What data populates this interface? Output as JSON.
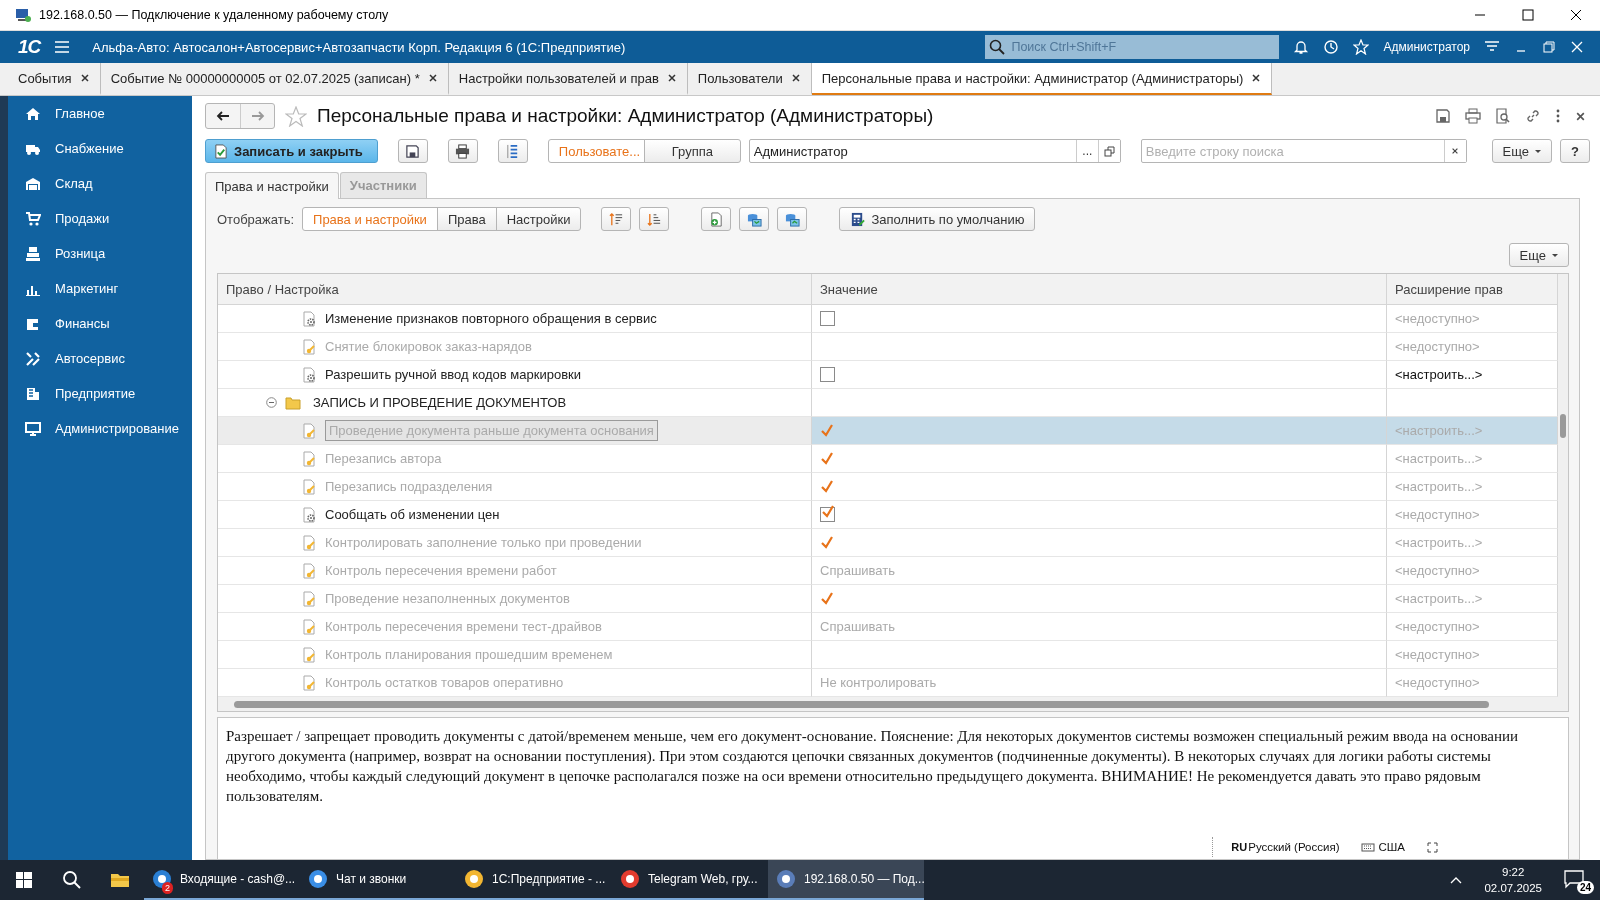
{
  "remote_window": {
    "title": "192.168.0.50 — Подключение к удаленному рабочему столу"
  },
  "app_header": {
    "logo": "1С",
    "title": "Альфа-Авто: Автосалон+Автосервис+Автозапчасти Корп. Редакция 6  (1С:Предприятие)",
    "search": {
      "placeholder": "Поиск Ctrl+Shift+F"
    },
    "user": "Администратор"
  },
  "open_tabs": [
    {
      "label": "События",
      "selected": false
    },
    {
      "label": "Событие № 00000000005 от 02.07.2025 (записан) *",
      "selected": false
    },
    {
      "label": "Настройки пользователей и прав",
      "selected": false
    },
    {
      "label": "Пользователи",
      "selected": false
    },
    {
      "label": "Персональные права и настройки: Администратор (Администраторы)",
      "selected": true
    }
  ],
  "sidebar": {
    "items": [
      {
        "label": "Главное"
      },
      {
        "label": "Снабжение"
      },
      {
        "label": "Склад"
      },
      {
        "label": "Продажи"
      },
      {
        "label": "Розница"
      },
      {
        "label": "Маркетинг"
      },
      {
        "label": "Финансы"
      },
      {
        "label": "Автосервис"
      },
      {
        "label": "Предприятие"
      },
      {
        "label": "Администрирование"
      }
    ]
  },
  "form": {
    "title": "Персональные права и настройки: Администратор (Администраторы)",
    "toolbar": {
      "save_close": "Записать и закрыть",
      "mode_toggle": [
        {
          "label": "Пользовате...",
          "selected": true
        },
        {
          "label": "Группа",
          "selected": false
        }
      ],
      "user_field": {
        "value": "Администратор",
        "select_button": "..."
      },
      "search": {
        "placeholder": "Введите строку поиска"
      },
      "more": "Еще",
      "help": "?"
    },
    "tabs": [
      {
        "label": "Права и настройки",
        "selected": true
      },
      {
        "label": "Участники",
        "selected": false
      }
    ],
    "filter": {
      "label": "Отображать:",
      "options": [
        {
          "label": "Права и настройки",
          "selected": true
        },
        {
          "label": "Права",
          "selected": false
        },
        {
          "label": "Настройки",
          "selected": false
        }
      ],
      "fill_default": "Заполнить по умолчанию",
      "more": "Еще"
    },
    "table": {
      "columns": [
        "Право / Настройка",
        "Значение",
        "Расширение прав"
      ],
      "rows": [
        {
          "kind": "setting",
          "label": "Изменение признаков повторного обращения в сервис",
          "disabled": false,
          "selected": false,
          "value": {
            "kind": "checkbox",
            "checked": false
          },
          "extension": {
            "text": "<недоступно>",
            "disabled": true
          }
        },
        {
          "kind": "right",
          "label": "Снятие блокировок заказ-нарядов",
          "disabled": true,
          "selected": false,
          "extension": {
            "text": "<недоступно>",
            "disabled": true
          }
        },
        {
          "kind": "setting",
          "label": "Разрешить ручной ввод кодов маркировки",
          "disabled": false,
          "selected": false,
          "value": {
            "kind": "checkbox",
            "checked": false
          },
          "extension": {
            "text": "<настроить...>",
            "disabled": false
          }
        },
        {
          "kind": "group",
          "label": "ЗАПИСЬ И ПРОВЕДЕНИЕ ДОКУМЕНТОВ",
          "expanded": true,
          "children": [
            {
              "kind": "right",
              "label": "Проведение документа раньше документа основания",
              "disabled": true,
              "selected": true,
              "value": {
                "kind": "checkbox",
                "checked": true
              },
              "extension": {
                "text": "<настроить...>",
                "disabled": true
              }
            },
            {
              "kind": "right",
              "label": "Перезапись автора",
              "disabled": true,
              "selected": false,
              "value": {
                "kind": "checkbox",
                "checked": true
              },
              "extension": {
                "text": "<настроить...>",
                "disabled": true
              }
            },
            {
              "kind": "right",
              "label": "Перезапись подразделения",
              "disabled": true,
              "selected": false,
              "value": {
                "kind": "checkbox",
                "checked": true
              },
              "extension": {
                "text": "<настроить...>",
                "disabled": true
              }
            },
            {
              "kind": "setting",
              "label": "Сообщать об изменении цен",
              "disabled": false,
              "selected": false,
              "value": {
                "kind": "checkbox",
                "checked": true
              },
              "extension": {
                "text": "<недоступно>",
                "disabled": true
              }
            },
            {
              "kind": "right",
              "label": "Контролировать заполнение только при проведении",
              "disabled": true,
              "selected": false,
              "value": {
                "kind": "checkbox",
                "checked": true
              },
              "extension": {
                "text": "<настроить...>",
                "disabled": true
              }
            },
            {
              "kind": "right",
              "label": "Контроль пересечения времени работ",
              "disabled": true,
              "selected": false,
              "value": {
                "kind": "text",
                "text": "Спрашивать"
              },
              "extension": {
                "text": "<недоступно>",
                "disabled": true
              }
            },
            {
              "kind": "right",
              "label": "Проведение незаполненных документов",
              "disabled": true,
              "selected": false,
              "value": {
                "kind": "checkbox",
                "checked": true
              },
              "extension": {
                "text": "<настроить...>",
                "disabled": true
              }
            },
            {
              "kind": "right",
              "label": "Контроль пересечения времени тест-драйвов",
              "disabled": true,
              "selected": false,
              "value": {
                "kind": "text",
                "text": "Спрашивать"
              },
              "extension": {
                "text": "<недоступно>",
                "disabled": true
              }
            },
            {
              "kind": "right",
              "label": "Контроль планирования прошедшим временем",
              "disabled": true,
              "selected": false,
              "extension": {
                "text": "<недоступно>",
                "disabled": true
              }
            },
            {
              "kind": "right",
              "label": "Контроль остатков товаров оперативно",
              "disabled": true,
              "selected": false,
              "value": {
                "kind": "text",
                "text": "Не контролировать"
              },
              "extension": {
                "text": "<недоступно>",
                "disabled": true
              }
            }
          ]
        }
      ]
    },
    "description": "Разрешает / запрещает проводить документы с датой/временем меньше, чем его документ-основание. Пояснение: Для некоторых документов системы возможен специальный режим ввода на основании другого документа (например, возврат на основании поступления). При этом создаются цепочки связанных документов (подчиненные документы). В некоторых случаях для логики работы системы необходимо, чтобы каждый следующий документ в цепочке располагался позже на оси времени относительно предыдущего документа. ВНИМАНИЕ! Не рекомендуется давать это право рядовым пользователям."
  },
  "language_bar": {
    "code": "RU",
    "name": "Русский (Россия)",
    "layout": "США"
  },
  "taskbar": {
    "items": [
      {
        "label": "Входящие - cash@...",
        "selected": false,
        "badge": "2"
      },
      {
        "label": "Чат и звонки",
        "selected": false
      },
      {
        "label": "1С:Предприятие - ...",
        "selected": false
      },
      {
        "label": "Telegram Web, гру...",
        "selected": false
      },
      {
        "label": "192.168.0.50 — Под...",
        "selected": true
      }
    ],
    "clock": {
      "time": "9:22",
      "date": "02.07.2025"
    },
    "notifications": "24"
  }
}
